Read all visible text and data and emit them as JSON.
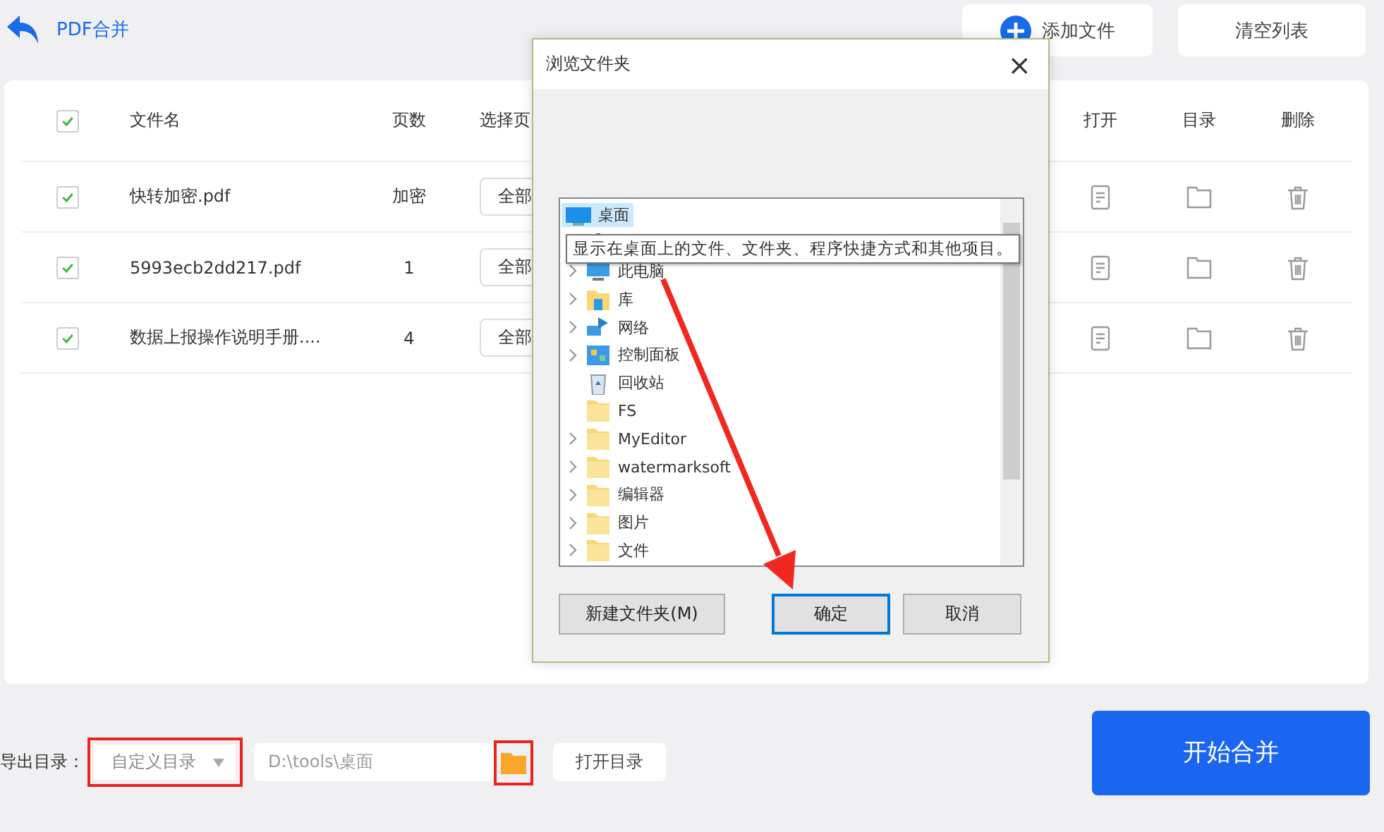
{
  "header": {
    "title": "PDF合并",
    "buttons": [
      {
        "kind": "add",
        "label": "添加文件"
      },
      {
        "kind": "plain",
        "label": "清空列表"
      }
    ]
  },
  "table": {
    "all_checked": true,
    "columns": [
      "文件名",
      "页数",
      "选择页",
      "打开",
      "目录",
      "删除"
    ],
    "rows": [
      {
        "checked": true,
        "name": "快转加密.pdf",
        "pages": "加密",
        "select": "全部"
      },
      {
        "checked": true,
        "name": "5993ecb2dd217.pdf",
        "pages": "1",
        "select": "全部"
      },
      {
        "checked": true,
        "name": "数据上报操作说明手册....",
        "pages": "4",
        "select": "全部"
      }
    ]
  },
  "footer": {
    "label": "导出目录：",
    "mode": "自定义目录",
    "mode_highlighted": true,
    "path": "D:\\tools\\桌面",
    "folder_highlighted": true,
    "open_button": "打开目录",
    "start_button": "开始合并"
  },
  "dialog": {
    "title": "浏览文件夹",
    "close": "×",
    "tree": {
      "label": "桌面",
      "kind": "desktop",
      "selected": true,
      "children": [
        {
          "kind": "user",
          "selected": false
        },
        {
          "label": "此电脑",
          "kind": "pc",
          "expandable": true,
          "selected": false
        },
        {
          "label": "库",
          "kind": "library",
          "expandable": true,
          "selected": false
        },
        {
          "label": "网络",
          "kind": "network",
          "expandable": true,
          "selected": false
        },
        {
          "label": "控制面板",
          "kind": "control",
          "expandable": true,
          "selected": false
        },
        {
          "label": "回收站",
          "kind": "recycle",
          "expandable": false,
          "selected": false
        },
        {
          "label": "FS",
          "kind": "folder",
          "expandable": false,
          "selected": false
        },
        {
          "label": "MyEditor",
          "kind": "folder",
          "expandable": true,
          "selected": false
        },
        {
          "label": "watermarksoft",
          "kind": "folder",
          "expandable": true,
          "selected": false
        },
        {
          "label": "编辑器",
          "kind": "folder",
          "expandable": true,
          "selected": false
        },
        {
          "label": "图片",
          "kind": "folder",
          "expandable": true,
          "selected": false
        },
        {
          "label": "文件",
          "kind": "folder",
          "expandable": true,
          "selected": false
        }
      ]
    },
    "tooltip": "显示在桌面上的文件、文件夹、程序快捷方式和其他项目。",
    "buttons": [
      {
        "label": "新建文件夹(M)",
        "default": false
      },
      {
        "label": "确定",
        "default": true
      },
      {
        "label": "取消",
        "default": false
      }
    ]
  }
}
